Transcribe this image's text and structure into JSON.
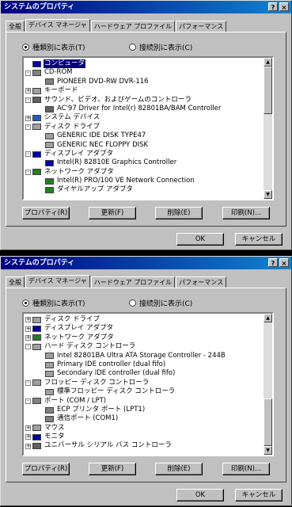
{
  "dialogs": [
    {
      "title": "システムのプロパティ",
      "title_buttons": [
        "?",
        "×"
      ],
      "tabs": [
        "全般",
        "デバイス マネージャ",
        "ハードウェア プロファイル",
        "パフォーマンス"
      ],
      "active_tab": 1,
      "radio_by_type": "種類別に表示(T)",
      "radio_by_connection": "接続別に表示(C)",
      "tree": [
        {
          "label": "コンピュータ",
          "level": 0,
          "expander": "",
          "icon": "computer-icon",
          "color": "#0000a8",
          "selected": true
        },
        {
          "label": "CD-ROM",
          "level": 0,
          "expander": "-",
          "icon": "cdrom-icon",
          "color": "#808080"
        },
        {
          "label": "PIONEER DVD-RW  DVR-116",
          "level": 1,
          "expander": "",
          "icon": "cdrom-icon",
          "color": "#808080"
        },
        {
          "label": "キーボード",
          "level": 0,
          "expander": "+",
          "icon": "keyboard-icon",
          "color": "#a0a0a0"
        },
        {
          "label": "サウンド、ビデオ、およびゲームのコントローラ",
          "level": 0,
          "expander": "-",
          "icon": "sound-icon",
          "color": "#606060"
        },
        {
          "label": "AC'97 Driver for Intel(r) 82801BA/BAM Controller",
          "level": 1,
          "expander": "",
          "icon": "sound-icon",
          "color": "#606060"
        },
        {
          "label": "システム デバイス",
          "level": 0,
          "expander": "+",
          "icon": "system-device-icon",
          "color": "#2060c0"
        },
        {
          "label": "ディスク ドライブ",
          "level": 0,
          "expander": "-",
          "icon": "disk-drive-icon",
          "color": "#a0a0a0"
        },
        {
          "label": "GENERIC IDE  DISK TYPE47",
          "level": 1,
          "expander": "",
          "icon": "disk-drive-icon",
          "color": "#a0a0a0"
        },
        {
          "label": "GENERIC NEC  FLOPPY DISK",
          "level": 1,
          "expander": "",
          "icon": "disk-drive-icon",
          "color": "#a0a0a0"
        },
        {
          "label": "ディスプレイ アダプタ",
          "level": 0,
          "expander": "-",
          "icon": "display-icon",
          "color": "#0000a8"
        },
        {
          "label": "Intel(R) 82810E Graphics Controller",
          "level": 1,
          "expander": "",
          "icon": "display-icon",
          "color": "#0000a8"
        },
        {
          "label": "ネットワーク アダプタ",
          "level": 0,
          "expander": "-",
          "icon": "network-icon",
          "color": "#208020"
        },
        {
          "label": "Intel(R) PRO/100 VE Network Connection",
          "level": 1,
          "expander": "",
          "icon": "network-icon",
          "color": "#208020"
        },
        {
          "label": "ダイヤルアップ アダプタ",
          "level": 1,
          "expander": "",
          "icon": "network-icon",
          "color": "#208020"
        }
      ],
      "scroll_position": 0.0,
      "buttons": [
        "プロパティ(R)",
        "更新(F)",
        "削除(E)",
        "印刷(N)..."
      ],
      "ok": "OK",
      "cancel": "キャンセル"
    },
    {
      "title": "システムのプロパティ",
      "title_buttons": [
        "?",
        "×"
      ],
      "tabs": [
        "全般",
        "デバイス マネージャ",
        "ハードウェア プロファイル",
        "パフォーマンス"
      ],
      "active_tab": 1,
      "radio_by_type": "種類別に表示(T)",
      "radio_by_connection": "接続別に表示(C)",
      "tree": [
        {
          "label": "ディスク ドライブ",
          "level": 0,
          "expander": "+",
          "icon": "disk-drive-icon",
          "color": "#a0a0a0"
        },
        {
          "label": "ディスプレイ アダプタ",
          "level": 0,
          "expander": "+",
          "icon": "display-icon",
          "color": "#0000a8"
        },
        {
          "label": "ネットワーク アダプタ",
          "level": 0,
          "expander": "+",
          "icon": "network-icon",
          "color": "#208020"
        },
        {
          "label": "ハード ディスク コントローラ",
          "level": 0,
          "expander": "-",
          "icon": "hdd-controller-icon",
          "color": "#a0a0a0"
        },
        {
          "label": "Intel 82801BA Ultra ATA Storage Controller - 244B",
          "level": 1,
          "expander": "",
          "icon": "hdd-controller-icon",
          "color": "#a0a0a0"
        },
        {
          "label": "Primary IDE controller (dual fifo)",
          "level": 1,
          "expander": "",
          "icon": "hdd-controller-icon",
          "color": "#a0a0a0"
        },
        {
          "label": "Secondary IDE controller (dual fifo)",
          "level": 1,
          "expander": "",
          "icon": "hdd-controller-icon",
          "color": "#a0a0a0"
        },
        {
          "label": "フロッピー ディスク コントローラ",
          "level": 0,
          "expander": "-",
          "icon": "floppy-controller-icon",
          "color": "#a0a0a0"
        },
        {
          "label": "標準フロッピー ディスク コントローラ",
          "level": 1,
          "expander": "",
          "icon": "floppy-controller-icon",
          "color": "#a0a0a0"
        },
        {
          "label": "ポート (COM / LPT)",
          "level": 0,
          "expander": "-",
          "icon": "port-icon",
          "color": "#808080"
        },
        {
          "label": "ECP プリンタ ポート (LPT1)",
          "level": 1,
          "expander": "",
          "icon": "port-icon",
          "color": "#808080"
        },
        {
          "label": "通信ポート (COM1)",
          "level": 1,
          "expander": "",
          "icon": "port-icon",
          "color": "#808080"
        },
        {
          "label": "マウス",
          "level": 0,
          "expander": "+",
          "icon": "mouse-icon",
          "color": "#a0a0a0"
        },
        {
          "label": "モニタ",
          "level": 0,
          "expander": "+",
          "icon": "monitor-icon",
          "color": "#0000a8"
        },
        {
          "label": "ユニバーサル シリアル バス コントローラ",
          "level": 0,
          "expander": "+",
          "icon": "usb-icon",
          "color": "#606060"
        }
      ],
      "scroll_position": 1.0,
      "buttons": [
        "プロパティ(R)",
        "更新(F)",
        "削除(E)",
        "印刷(N)..."
      ],
      "ok": "OK",
      "cancel": "キャンセル"
    }
  ]
}
